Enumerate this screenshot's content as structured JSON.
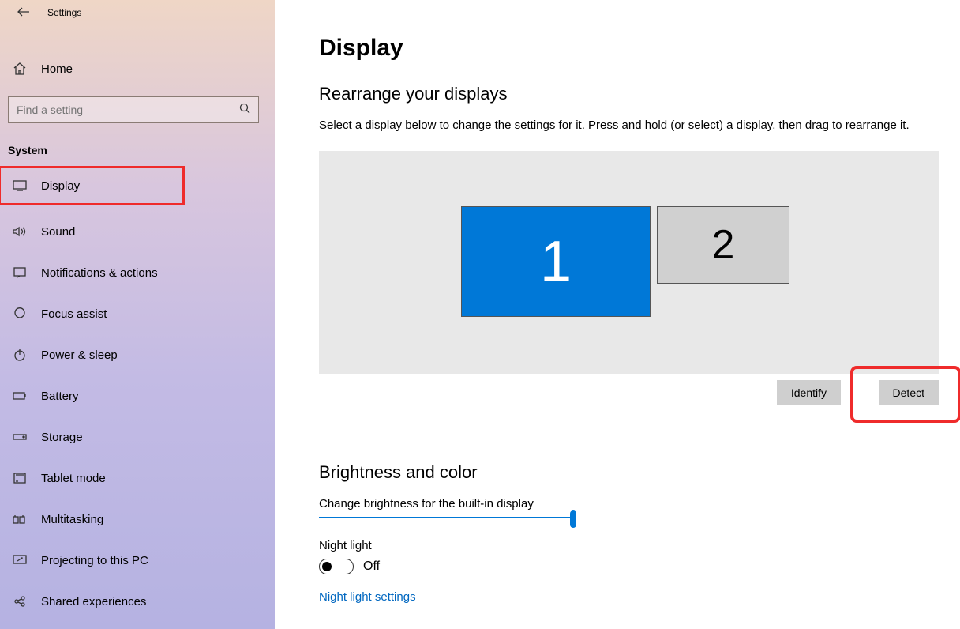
{
  "app": {
    "title": "Settings"
  },
  "sidebar": {
    "home": "Home",
    "search_placeholder": "Find a setting",
    "category": "System",
    "items": [
      {
        "label": "Display"
      },
      {
        "label": "Sound"
      },
      {
        "label": "Notifications & actions"
      },
      {
        "label": "Focus assist"
      },
      {
        "label": "Power & sleep"
      },
      {
        "label": "Battery"
      },
      {
        "label": "Storage"
      },
      {
        "label": "Tablet mode"
      },
      {
        "label": "Multitasking"
      },
      {
        "label": "Projecting to this PC"
      },
      {
        "label": "Shared experiences"
      }
    ]
  },
  "main": {
    "title": "Display",
    "rearrange_heading": "Rearrange your displays",
    "rearrange_hint": "Select a display below to change the settings for it. Press and hold (or select) a display, then drag to rearrange it.",
    "monitor1": "1",
    "monitor2": "2",
    "identify": "Identify",
    "detect": "Detect",
    "brightness_heading": "Brightness and color",
    "brightness_label": "Change brightness for the built-in display",
    "nightlight_label": "Night light",
    "nightlight_state": "Off",
    "nightlight_link": "Night light settings"
  }
}
